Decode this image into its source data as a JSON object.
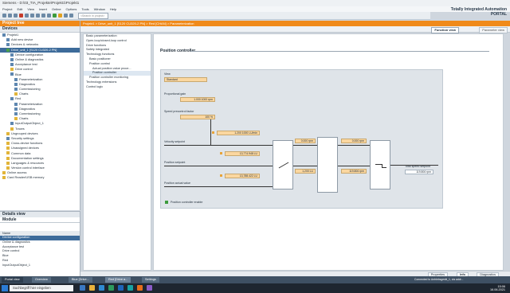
{
  "window": {
    "title": "Siemens - D:\\03_TIA_Projekte\\Projekt1\\Projekt1",
    "brand_line1": "Totally Integrated Automation",
    "brand_line2": "PORTAL"
  },
  "menu": [
    "Project",
    "Edit",
    "View",
    "Insert",
    "Online",
    "Options",
    "Tools",
    "Window",
    "Help"
  ],
  "toolbar": {
    "search_placeholder": "<Search in project>"
  },
  "project_tree": {
    "header": "Project tree",
    "tab": "Devices",
    "items": [
      {
        "label": "Projekt1",
        "indent": 0,
        "icon": "project-icon"
      },
      {
        "label": "Add new device",
        "indent": 1,
        "icon": "add-device-icon"
      },
      {
        "label": "Devices & networks",
        "indent": 1,
        "icon": "network-icon"
      },
      {
        "label": "Drive_unit_1 [S120 CU320-2 PN]",
        "indent": 1,
        "icon": "drive-icon",
        "selected": true
      },
      {
        "label": "Device configuration",
        "indent": 2,
        "icon": "config-icon"
      },
      {
        "label": "Online & diagnostics",
        "indent": 2,
        "icon": "diagnostics-icon"
      },
      {
        "label": "Acceptance test",
        "indent": 2,
        "icon": "test-icon"
      },
      {
        "label": "Drive control",
        "indent": 2,
        "icon": "folder-icon"
      },
      {
        "label": "Blue",
        "indent": 2,
        "icon": "axis-icon"
      },
      {
        "label": "Parameterization",
        "indent": 3,
        "icon": "param-icon"
      },
      {
        "label": "Diagnostics",
        "indent": 3,
        "icon": "diagnostics-icon"
      },
      {
        "label": "Commissioning",
        "indent": 3,
        "icon": "commissioning-icon"
      },
      {
        "label": "Charts",
        "indent": 3,
        "icon": "folder-icon"
      },
      {
        "label": "Red",
        "indent": 2,
        "icon": "axis-icon"
      },
      {
        "label": "Parameterization",
        "indent": 3,
        "icon": "param-icon"
      },
      {
        "label": "Diagnostics",
        "indent": 3,
        "icon": "diagnostics-icon"
      },
      {
        "label": "Commissioning",
        "indent": 3,
        "icon": "commissioning-icon"
      },
      {
        "label": "Charts",
        "indent": 3,
        "icon": "folder-icon"
      },
      {
        "label": "InputOutputObject_1",
        "indent": 2,
        "icon": "io-icon"
      },
      {
        "label": "Traces",
        "indent": 2,
        "icon": "folder-icon"
      },
      {
        "label": "Ungrouped devices",
        "indent": 1,
        "icon": "folder-icon"
      },
      {
        "label": "Security settings",
        "indent": 1,
        "icon": "security-icon"
      },
      {
        "label": "Cross-device functions",
        "indent": 1,
        "icon": "folder-icon"
      },
      {
        "label": "Unassigned devices",
        "indent": 1,
        "icon": "folder-icon"
      },
      {
        "label": "Common data",
        "indent": 1,
        "icon": "folder-icon"
      },
      {
        "label": "Documentation settings",
        "indent": 1,
        "icon": "folder-icon"
      },
      {
        "label": "Languages & resources",
        "indent": 1,
        "icon": "folder-icon"
      },
      {
        "label": "Version control interface",
        "indent": 1,
        "icon": "folder-icon"
      },
      {
        "label": "Online access",
        "indent": 0,
        "icon": "folder-icon"
      },
      {
        "label": "Card Reader/USB memory",
        "indent": 0,
        "icon": "folder-icon"
      }
    ]
  },
  "details": {
    "header": "Details view",
    "tab": "Module",
    "column": "Name",
    "items": [
      "Device configuration",
      "Online & diagnostics",
      "Acceptance test",
      "Drive control",
      "Blue",
      "Red",
      "InputOutputObject_1"
    ]
  },
  "editor": {
    "breadcrumb": "Projekt1 > Drive_unit_1 [S120 CU320-2 PN] > Red [CHAN] > Parameterization",
    "function_view": "Function view",
    "parameter_view": "Parameter view"
  },
  "nav": {
    "items": [
      {
        "label": "Basic parameterization",
        "indent": 0
      },
      {
        "label": "Open-loop/closed-loop control",
        "indent": 0
      },
      {
        "label": "Drive functions",
        "indent": 0
      },
      {
        "label": "Safety Integrated",
        "indent": 0
      },
      {
        "label": "Technology functions",
        "indent": 0
      },
      {
        "label": "Basic positioner",
        "indent": 1
      },
      {
        "label": "Position control",
        "indent": 1
      },
      {
        "label": "Actual position value proce...",
        "indent": 2
      },
      {
        "label": "Position controller",
        "indent": 2,
        "selected": true
      },
      {
        "label": "Position controller monitoring",
        "indent": 1
      },
      {
        "label": "Technology extensions",
        "indent": 0
      },
      {
        "label": "Control logic",
        "indent": 0
      }
    ]
  },
  "position_controller": {
    "title": "Position controller",
    "view_label": "View",
    "view_value": "Standard",
    "p_gain_label": "Proportional gain",
    "p_gain_value": "1.000   1000 rpm",
    "speed_factor_label": "Speed precontrol factor",
    "speed_factor_value": "100 %",
    "labels": {
      "velocity_setpoint": "Velocity setpoint",
      "position_setpoint": "Position setpoint",
      "position_actual": "Position actual value",
      "total_speed": "Total speed setpoint"
    },
    "values": {
      "v1": "1.200   1000 LU/min",
      "v2": "13,774.948 LU",
      "v3": "13,788.422 LU",
      "v4": "0.000 rpm",
      "v5": "0.000 rpm",
      "v6": "1,200 LU",
      "v7": "119.806 rpm",
      "v8": "119.806 rpm"
    },
    "enable_label": "Position controller enable"
  },
  "bottom_tabs": [
    "Properties",
    "Info",
    "Diagnostics"
  ],
  "portal": {
    "portal_view": "Portal view",
    "tabs": [
      "Overview",
      "Blue [Drive...",
      "Red [Drive a...",
      "Settings"
    ],
    "status": "Connected to Antriebsgerät_1, via addr..."
  },
  "taskbar": {
    "search_placeholder": "Suchbegriff hier eingeben",
    "time": "15:06",
    "date": "16.06.2021"
  }
}
